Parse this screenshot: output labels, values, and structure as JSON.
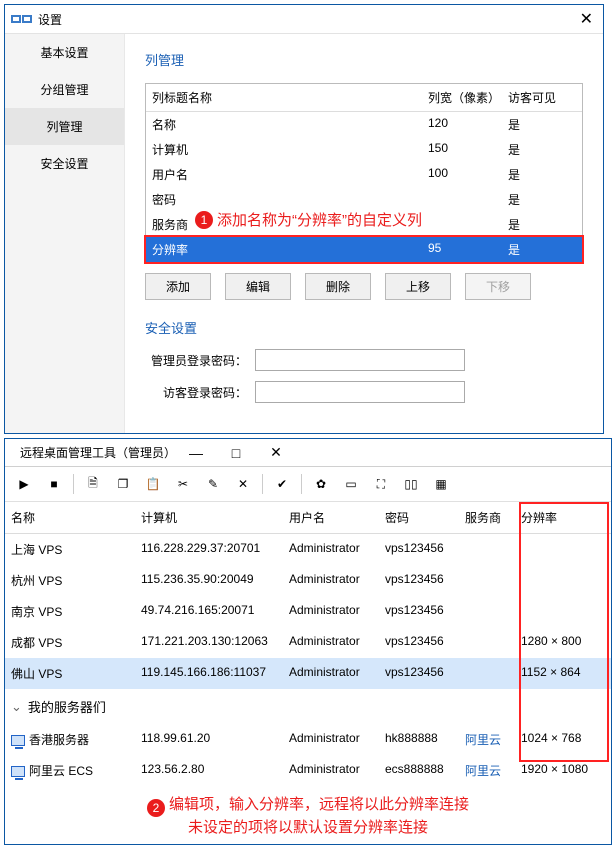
{
  "settings": {
    "title": "设置",
    "nav": [
      "基本设置",
      "分组管理",
      "列管理",
      "安全设置"
    ],
    "active_nav": 2,
    "section_title": "列管理",
    "table": {
      "headers": [
        "列标题名称",
        "列宽（像素）",
        "访客可见"
      ],
      "rows": [
        {
          "name": "名称",
          "width": "120",
          "vis": "是",
          "sel": false
        },
        {
          "name": "计算机",
          "width": "150",
          "vis": "是",
          "sel": false
        },
        {
          "name": "用户名",
          "width": "100",
          "vis": "是",
          "sel": false
        },
        {
          "name": "密码",
          "width": "",
          "vis": "是",
          "sel": false
        },
        {
          "name": "服务商",
          "width": "",
          "vis": "是",
          "sel": false
        },
        {
          "name": "分辨率",
          "width": "95",
          "vis": "是",
          "sel": true
        }
      ]
    },
    "buttons": {
      "add": "添加",
      "edit": "编辑",
      "del": "删除",
      "up": "上移",
      "down": "下移"
    },
    "security_title": "安全设置",
    "admin_pw": "管理员登录密码：",
    "guest_pw": "访客登录密码：",
    "callout1": "添加名称为“分辨率”的自定义列"
  },
  "manager": {
    "title": "远程桌面管理工具（管理员）",
    "headers": [
      "名称",
      "计算机",
      "用户名",
      "密码",
      "服务商",
      "分辨率"
    ],
    "rows": [
      {
        "name": "上海 VPS",
        "host": "116.228.229.37:20701",
        "user": "Administrator",
        "pw": "vps123456",
        "vendor": "",
        "res": ""
      },
      {
        "name": "杭州 VPS",
        "host": "115.236.35.90:20049",
        "user": "Administrator",
        "pw": "vps123456",
        "vendor": "",
        "res": ""
      },
      {
        "name": "南京 VPS",
        "host": "49.74.216.165:20071",
        "user": "Administrator",
        "pw": "vps123456",
        "vendor": "",
        "res": ""
      },
      {
        "name": "成都 VPS",
        "host": "171.221.203.130:12063",
        "user": "Administrator",
        "pw": "vps123456",
        "vendor": "",
        "res": "1280 × 800"
      },
      {
        "name": "佛山 VPS",
        "host": "119.145.166.186:11037",
        "user": "Administrator",
        "pw": "vps123456",
        "vendor": "",
        "res": "1152 × 864",
        "sel": true
      }
    ],
    "group": "我的服务器们",
    "group_rows": [
      {
        "name": "香港服务器",
        "host": "118.99.61.20",
        "user": "Administrator",
        "pw": "hk888888",
        "vendor": "阿里云",
        "res": "1024 × 768"
      },
      {
        "name": "阿里云 ECS",
        "host": "123.56.2.80",
        "user": "Administrator",
        "pw": "ecs888888",
        "vendor": "阿里云",
        "res": "1920 × 1080"
      }
    ],
    "callout2_line1": "编辑项，输入分辨率，远程将以此分辨率连接",
    "callout2_line2": "未设定的项将以默认设置分辨率连接"
  }
}
